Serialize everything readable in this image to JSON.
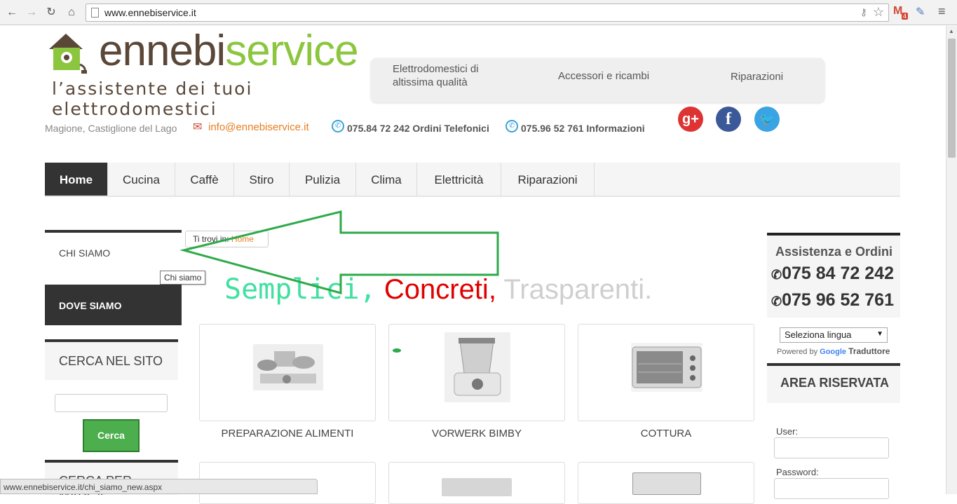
{
  "browser": {
    "url": "www.ennebiservice.it",
    "gmail_badge": "4",
    "status_url": "www.ennebiservice.it/chi_siamo_new.aspx"
  },
  "header": {
    "brand_part1": "ennebi",
    "brand_part2": "service",
    "tagline": "l’assistente dei tuoi elettrodomestici",
    "topnav": [
      {
        "label_line1": "Elettrodomestici di",
        "label_line2": "altissima qualità"
      },
      {
        "label": "Accessori e ricambi"
      },
      {
        "label": "Riparazioni"
      }
    ],
    "location": "Magione, Castiglione del Lago",
    "email": "info@ennebiservice.it",
    "phone1": "075.84 72 242 Ordini Telefonici",
    "phone2": "075.96 52 761 Informazioni",
    "social": {
      "google_color": "#dd3333",
      "facebook_color": "#3b5998",
      "twitter_color": "#3aa3e3"
    }
  },
  "mainmenu": [
    "Home",
    "Cucina",
    "Caffè",
    "Stiro",
    "Pulizia",
    "Clima",
    "Elettricità",
    "Riparazioni"
  ],
  "sidebar_left": {
    "chi_siamo": "CHI SIAMO",
    "tooltip": "Chi siamo",
    "dove_siamo": "DOVE SIAMO",
    "cerca_title": "CERCA NEL SITO",
    "cerca_button": "Cerca",
    "marca_title": "CERCA PER MARCA"
  },
  "breadcrumb": {
    "prefix": "Ti trovi in: ",
    "home": "Home"
  },
  "slogan": {
    "w1": "Semplici,",
    "w2": "Concreti,",
    "w3": "Trasparenti."
  },
  "products": [
    {
      "label": "PREPARAZIONE ALIMENTI"
    },
    {
      "label": "VORWERK BIMBY"
    },
    {
      "label": "COTTURA"
    }
  ],
  "sidebar_right": {
    "assist_title": "Assistenza e Ordini",
    "assist_phone1": "075 84 72 242",
    "assist_phone2": "075 96 52 761",
    "lang_select": "Seleziona lingua",
    "powered_prefix": "Powered by",
    "powered_google": "Google",
    "powered_translate": "Traduttore",
    "area_title": "AREA RISERVATA",
    "user_label": "User:",
    "password_label": "Password:"
  },
  "colors": {
    "accent_green": "#8cc63f",
    "brand_brown": "#5a4738",
    "menu_active": "#333333",
    "arrow_green": "#2eaa4a"
  }
}
